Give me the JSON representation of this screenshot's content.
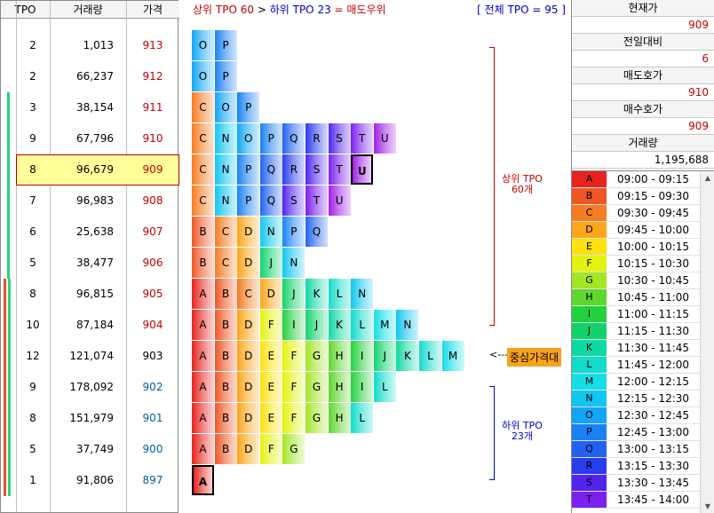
{
  "left_table": {
    "headers": {
      "tpo": "TPO",
      "volume": "거래량",
      "price": "가격"
    },
    "rows": [
      {
        "tpo": "2",
        "volume": "1,013",
        "price": "913",
        "price_color": "#c00000"
      },
      {
        "tpo": "2",
        "volume": "66,237",
        "price": "912",
        "price_color": "#c00000"
      },
      {
        "tpo": "3",
        "volume": "38,154",
        "price": "911",
        "price_color": "#c00000"
      },
      {
        "tpo": "9",
        "volume": "67,796",
        "price": "910",
        "price_color": "#c00000"
      },
      {
        "tpo": "8",
        "volume": "96,679",
        "price": "909",
        "price_color": "#c00000",
        "selected": true
      },
      {
        "tpo": "7",
        "volume": "96,983",
        "price": "908",
        "price_color": "#c00000"
      },
      {
        "tpo": "6",
        "volume": "25,638",
        "price": "907",
        "price_color": "#c00000"
      },
      {
        "tpo": "5",
        "volume": "38,477",
        "price": "906",
        "price_color": "#c00000"
      },
      {
        "tpo": "8",
        "volume": "96,815",
        "price": "905",
        "price_color": "#c00000"
      },
      {
        "tpo": "10",
        "volume": "87,184",
        "price": "904",
        "price_color": "#c00000"
      },
      {
        "tpo": "12",
        "volume": "121,074",
        "price": "903",
        "price_color": "#000000"
      },
      {
        "tpo": "9",
        "volume": "178,092",
        "price": "902",
        "price_color": "#0060a0"
      },
      {
        "tpo": "8",
        "volume": "151,979",
        "price": "901",
        "price_color": "#0060a0"
      },
      {
        "tpo": "5",
        "volume": "37,749",
        "price": "900",
        "price_color": "#0060a0"
      },
      {
        "tpo": "1",
        "volume": "91,806",
        "price": "897",
        "price_color": "#0060a0"
      }
    ]
  },
  "chart": {
    "header_upper": "상위 TPO 60",
    "header_gt": ">",
    "header_lower": "하위 TPO 23",
    "header_eq": "= 매도우위",
    "header_total": "[ 전체 TPO = 95 ]",
    "upper_label": "상위 TPO\n60개",
    "lower_label": "하위 TPO\n23개",
    "center_arrow": "<----",
    "center_label": "중심가격대",
    "rows": [
      {
        "letters": [
          "O",
          "P"
        ]
      },
      {
        "letters": [
          "O",
          "P"
        ]
      },
      {
        "letters": [
          "C",
          "O",
          "P"
        ]
      },
      {
        "letters": [
          "C",
          "N",
          "O",
          "P",
          "Q",
          "R",
          "S",
          "T",
          "U"
        ]
      },
      {
        "letters": [
          "C",
          "N",
          "P",
          "Q",
          "R",
          "S",
          "T",
          "U"
        ],
        "mark": 7
      },
      {
        "letters": [
          "C",
          "N",
          "P",
          "Q",
          "S",
          "T",
          "U"
        ]
      },
      {
        "letters": [
          "B",
          "C",
          "D",
          "N",
          "P",
          "Q"
        ]
      },
      {
        "letters": [
          "B",
          "C",
          "D",
          "J",
          "N"
        ]
      },
      {
        "letters": [
          "A",
          "B",
          "C",
          "D",
          "J",
          "K",
          "L",
          "N"
        ]
      },
      {
        "letters": [
          "A",
          "B",
          "D",
          "F",
          "I",
          "J",
          "K",
          "L",
          "M",
          "N"
        ]
      },
      {
        "letters": [
          "A",
          "B",
          "D",
          "E",
          "F",
          "G",
          "H",
          "I",
          "J",
          "K",
          "L",
          "M"
        ]
      },
      {
        "letters": [
          "A",
          "B",
          "D",
          "E",
          "F",
          "G",
          "H",
          "I",
          "L"
        ]
      },
      {
        "letters": [
          "A",
          "B",
          "D",
          "E",
          "F",
          "G",
          "H",
          "L"
        ]
      },
      {
        "letters": [
          "A",
          "B",
          "D",
          "F",
          "G"
        ]
      },
      {
        "letters": [
          "A"
        ],
        "mark": 0
      }
    ]
  },
  "right_panel": {
    "current_price_label": "현재가",
    "current_price": "909",
    "change_label": "전일대비",
    "change": "6",
    "ask_label": "매도호가",
    "ask": "910",
    "bid_label": "매수호가",
    "bid": "909",
    "volume_label": "거래량",
    "volume": "1,195,688"
  },
  "legend": [
    {
      "letter": "A",
      "time": "09:00 - 09:15",
      "color": "#e8231d"
    },
    {
      "letter": "B",
      "time": "09:15 - 09:30",
      "color": "#f05525"
    },
    {
      "letter": "C",
      "time": "09:30 - 09:45",
      "color": "#f57c20"
    },
    {
      "letter": "D",
      "time": "09:45 - 10:00",
      "color": "#fca619"
    },
    {
      "letter": "E",
      "time": "10:00 - 10:15",
      "color": "#fde10d"
    },
    {
      "letter": "F",
      "time": "10:15 - 10:30",
      "color": "#e3f20f"
    },
    {
      "letter": "G",
      "time": "10:30 - 10:45",
      "color": "#a3e624"
    },
    {
      "letter": "H",
      "time": "10:45 - 11:00",
      "color": "#5ed82e"
    },
    {
      "letter": "I",
      "time": "11:00 - 11:15",
      "color": "#23d13d"
    },
    {
      "letter": "J",
      "time": "11:15 - 11:30",
      "color": "#10d36e"
    },
    {
      "letter": "K",
      "time": "11:30 - 11:45",
      "color": "#0fd9a3"
    },
    {
      "letter": "L",
      "time": "11:45 - 12:00",
      "color": "#10dccb"
    },
    {
      "letter": "M",
      "time": "12:00 - 12:15",
      "color": "#14dfe6"
    },
    {
      "letter": "N",
      "time": "12:15 - 12:30",
      "color": "#11c6f0"
    },
    {
      "letter": "O",
      "time": "12:30 - 12:45",
      "color": "#12a5f5"
    },
    {
      "letter": "P",
      "time": "12:45 - 13:00",
      "color": "#1a82f5"
    },
    {
      "letter": "Q",
      "time": "13:00 - 13:15",
      "color": "#2262f3"
    },
    {
      "letter": "R",
      "time": "13:15 - 13:30",
      "color": "#2a3cf0"
    },
    {
      "letter": "S",
      "time": "13:30 - 13:45",
      "color": "#5124f0"
    },
    {
      "letter": "T",
      "time": "13:45 - 14:00",
      "color": "#7a20ef"
    }
  ],
  "letter_colors": {
    "A": "#e8231d",
    "B": "#f05525",
    "C": "#f57c20",
    "D": "#fca619",
    "E": "#fde10d",
    "F": "#e3f20f",
    "G": "#a3e624",
    "H": "#5ed82e",
    "I": "#23d13d",
    "J": "#10d36e",
    "K": "#0fd9a3",
    "L": "#10dccb",
    "M": "#14dfe6",
    "N": "#11c6f0",
    "O": "#12a5f5",
    "P": "#1a82f5",
    "Q": "#2262f3",
    "R": "#2a3cf0",
    "S": "#5124f0",
    "T": "#7a20ef",
    "U": "#a020e6"
  }
}
